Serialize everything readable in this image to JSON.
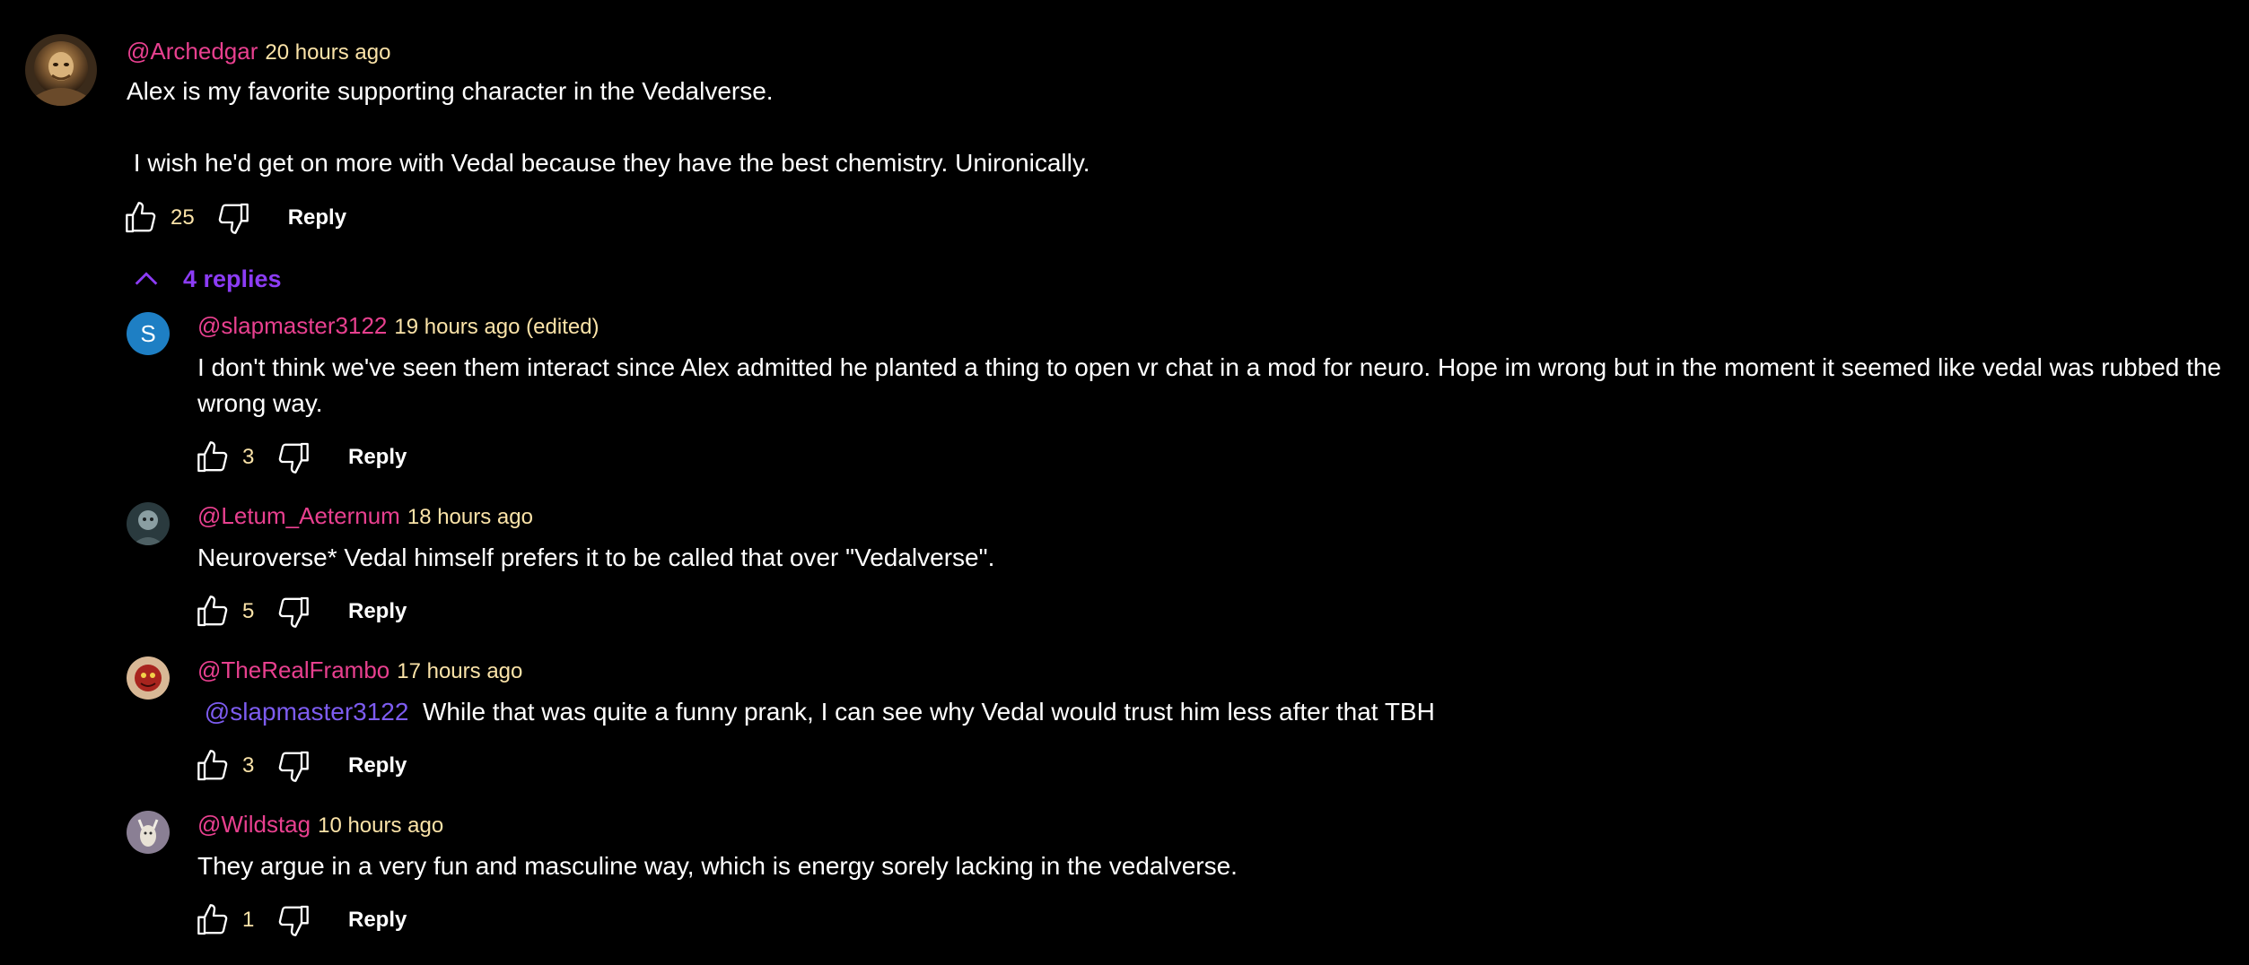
{
  "comments": {
    "top": {
      "author": "@Archedgar",
      "time": "20 hours ago",
      "text": "Alex is my favorite supporting character in the Vedalverse.\n\n I wish he'd get on more with Vedal because they have the best chemistry. Unironically.",
      "likes": "25",
      "reply_label": "Reply",
      "avatar_icon": "armored-warrior-avatar"
    },
    "replies_toggle": "4 replies",
    "replies": [
      {
        "author": "@slapmaster3122",
        "time": "19 hours ago (edited)",
        "text": "I don't think we've seen them interact since Alex admitted he planted a thing to open vr chat in a mod for neuro. Hope im wrong but in the moment it seemed like vedal was rubbed the wrong way.",
        "likes": "3",
        "reply_label": "Reply",
        "avatar_letter": "S",
        "avatar_color": "#1e7fc4"
      },
      {
        "author": "@Letum_Aeternum",
        "time": "18 hours ago",
        "text": "Neuroverse* Vedal himself prefers it to be called that over \"Vedalverse\".",
        "likes": "5",
        "reply_label": "Reply",
        "avatar_icon": "dark-portrait-avatar"
      },
      {
        "author": "@TheRealFrambo",
        "time": "17 hours ago",
        "mention": "@slapmaster3122",
        "text": "While that was quite a funny prank, I can see why Vedal would trust him less after that TBH",
        "likes": "3",
        "reply_label": "Reply",
        "avatar_icon": "red-creature-avatar"
      },
      {
        "author": "@Wildstag",
        "time": "10 hours ago",
        "text": "They argue in a very fun and masculine way, which is energy sorely lacking in the vedalverse.",
        "likes": "1",
        "reply_label": "Reply",
        "avatar_icon": "stag-avatar"
      }
    ]
  },
  "colors": {
    "background": "#000000",
    "author": "#e8408f",
    "timestamp": "#fbe3a8",
    "replies_toggle": "#8c3cf5",
    "mention": "#7d5cf0"
  }
}
